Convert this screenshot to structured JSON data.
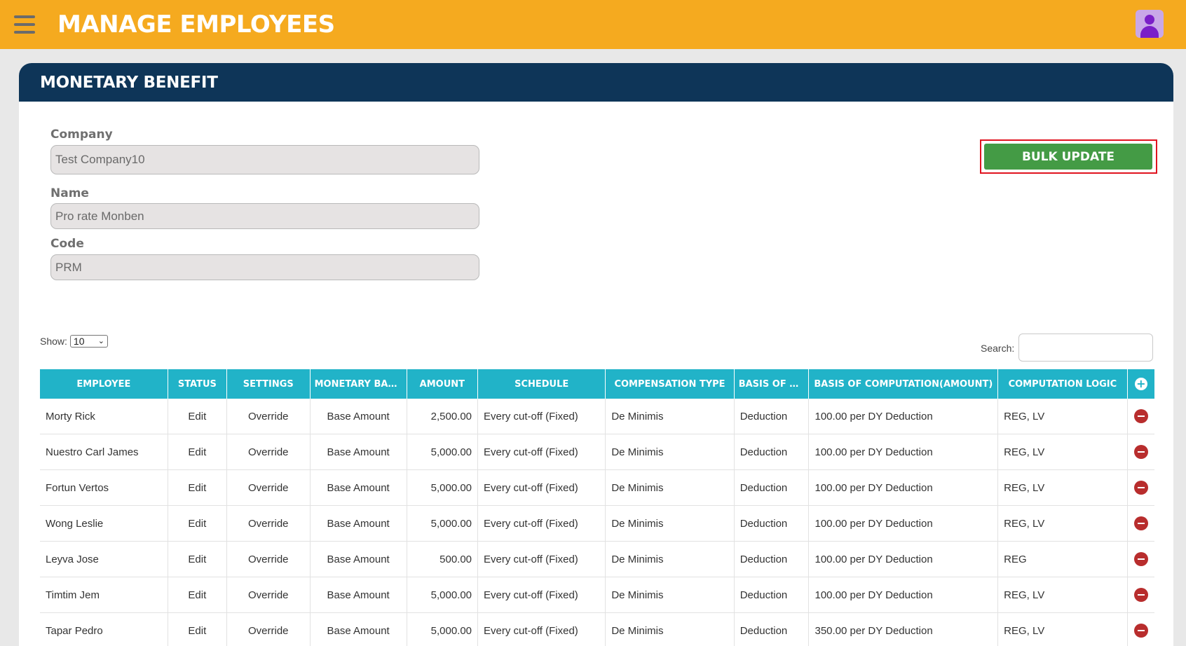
{
  "header": {
    "title": "MANAGE EMPLOYEES"
  },
  "card": {
    "title": "MONETARY BENEFIT"
  },
  "form": {
    "company_label": "Company",
    "company_value": "Test Company10",
    "name_label": "Name",
    "name_value": "Pro rate Monben",
    "code_label": "Code",
    "code_value": "PRM"
  },
  "bulk_update_label": "BULK UPDATE",
  "table_controls": {
    "show_label": "Show:",
    "show_value": "10",
    "search_label": "Search:"
  },
  "table": {
    "columns": [
      "EMPLOYEE",
      "STATUS",
      "SETTINGS",
      "MONETARY BAS...",
      "AMOUNT",
      "SCHEDULE",
      "COMPENSATION TYPE",
      "BASIS OF C...",
      "BASIS OF COMPUTATION(AMOUNT)",
      "COMPUTATION LOGIC"
    ],
    "rows": [
      {
        "employee": "Morty Rick",
        "status": "Edit",
        "settings": "Override",
        "monetary_basis": "Base Amount",
        "amount": "2,500.00",
        "schedule": "Every cut-off (Fixed)",
        "compensation_type": "De Minimis",
        "basis": "Deduction",
        "basis_amount": "100.00 per DY Deduction",
        "logic": "REG, LV"
      },
      {
        "employee": "Nuestro Carl James",
        "status": "Edit",
        "settings": "Override",
        "monetary_basis": "Base Amount",
        "amount": "5,000.00",
        "schedule": "Every cut-off (Fixed)",
        "compensation_type": "De Minimis",
        "basis": "Deduction",
        "basis_amount": "100.00 per DY Deduction",
        "logic": "REG, LV"
      },
      {
        "employee": "Fortun Vertos",
        "status": "Edit",
        "settings": "Override",
        "monetary_basis": "Base Amount",
        "amount": "5,000.00",
        "schedule": "Every cut-off (Fixed)",
        "compensation_type": "De Minimis",
        "basis": "Deduction",
        "basis_amount": "100.00 per DY Deduction",
        "logic": "REG, LV"
      },
      {
        "employee": "Wong Leslie",
        "status": "Edit",
        "settings": "Override",
        "monetary_basis": "Base Amount",
        "amount": "5,000.00",
        "schedule": "Every cut-off (Fixed)",
        "compensation_type": "De Minimis",
        "basis": "Deduction",
        "basis_amount": "100.00 per DY Deduction",
        "logic": "REG, LV"
      },
      {
        "employee": "Leyva Jose",
        "status": "Edit",
        "settings": "Override",
        "monetary_basis": "Base Amount",
        "amount": "500.00",
        "schedule": "Every cut-off (Fixed)",
        "compensation_type": "De Minimis",
        "basis": "Deduction",
        "basis_amount": "100.00 per DY Deduction",
        "logic": "REG"
      },
      {
        "employee": "Timtim Jem",
        "status": "Edit",
        "settings": "Override",
        "monetary_basis": "Base Amount",
        "amount": "5,000.00",
        "schedule": "Every cut-off (Fixed)",
        "compensation_type": "De Minimis",
        "basis": "Deduction",
        "basis_amount": "100.00 per DY Deduction",
        "logic": "REG, LV"
      },
      {
        "employee": "Tapar Pedro",
        "status": "Edit",
        "settings": "Override",
        "monetary_basis": "Base Amount",
        "amount": "5,000.00",
        "schedule": "Every cut-off (Fixed)",
        "compensation_type": "De Minimis",
        "basis": "Deduction",
        "basis_amount": "350.00 per DY Deduction",
        "logic": "REG, LV"
      }
    ]
  },
  "icons": {
    "menu": "hamburger-menu-icon",
    "avatar": "user-avatar-icon",
    "add": "plus-circle-icon",
    "remove": "minus-circle-icon"
  },
  "colors": {
    "topbar": "#f5aa1f",
    "card_header": "#0e3558",
    "table_header": "#21b3c8",
    "bulk_button": "#449b45",
    "highlight_frame": "#e0131f",
    "remove_icon": "#b82d2d",
    "link": "#2a73b8"
  }
}
